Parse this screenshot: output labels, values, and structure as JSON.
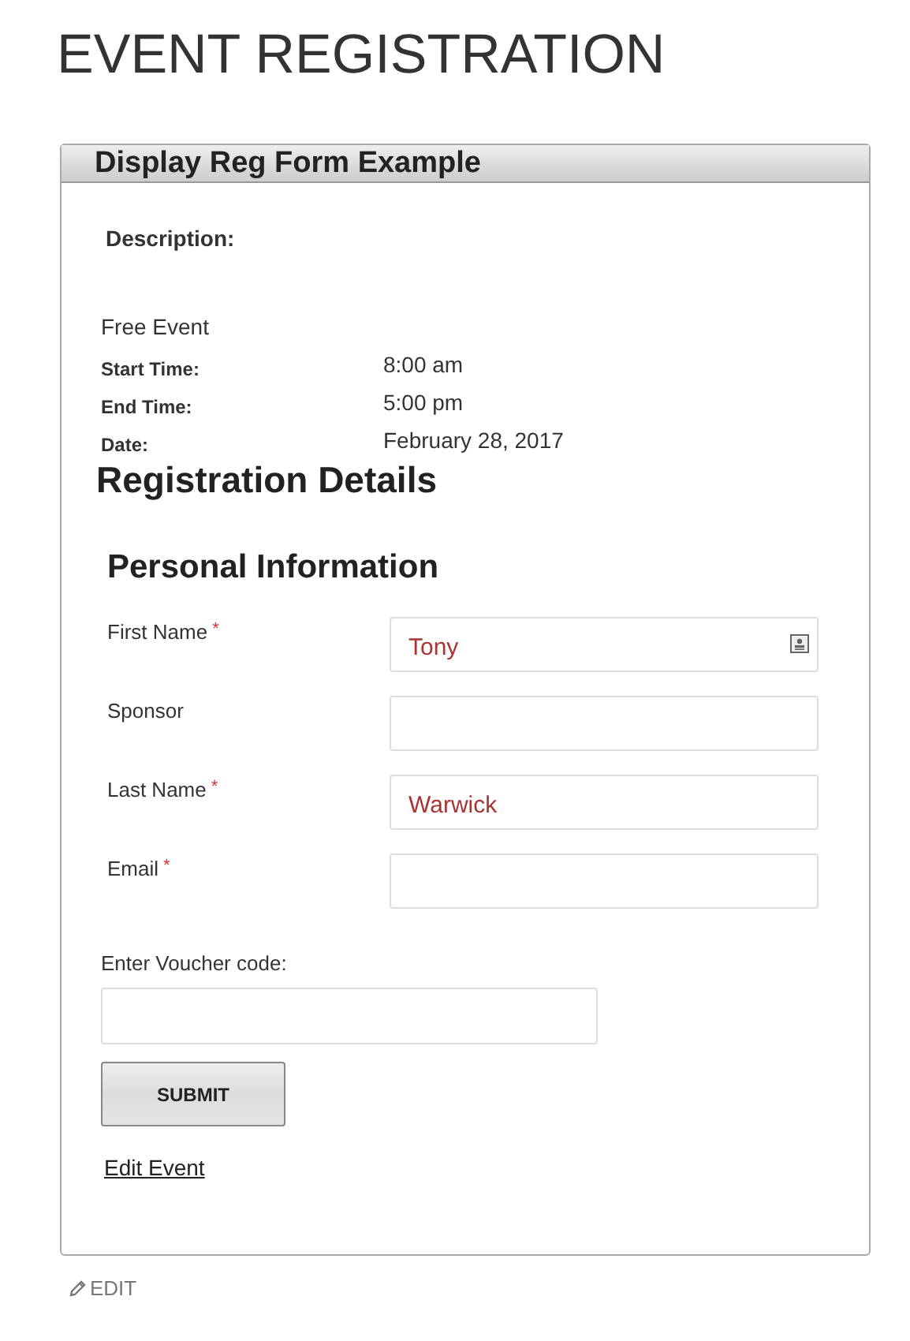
{
  "page_title": "EVENT REGISTRATION",
  "event": {
    "title": "Display Reg Form Example",
    "description_label": "Description:",
    "price": "Free Event",
    "details": [
      {
        "label": "Start Time:",
        "value": "8:00 am"
      },
      {
        "label": "End Time:",
        "value": "5:00 pm"
      },
      {
        "label": "Date:",
        "value": "February 28, 2017"
      }
    ]
  },
  "registration": {
    "heading": "Registration Details",
    "section": "Personal Information",
    "fields": [
      {
        "label": "First Name",
        "required": true,
        "value": "Tony",
        "contact_icon": true
      },
      {
        "label": "Sponsor",
        "required": false,
        "contact_icon": false
      },
      {
        "label": "Last Name",
        "required": true,
        "value": "Warwick",
        "contact_icon": false
      },
      {
        "label": "Email",
        "required": true,
        "contact_icon": false
      }
    ],
    "required_mark": "*",
    "voucher_label": "Enter Voucher code:",
    "submit": "SUBMIT",
    "edit_event": "Edit Event"
  },
  "edit_link": "EDIT"
}
